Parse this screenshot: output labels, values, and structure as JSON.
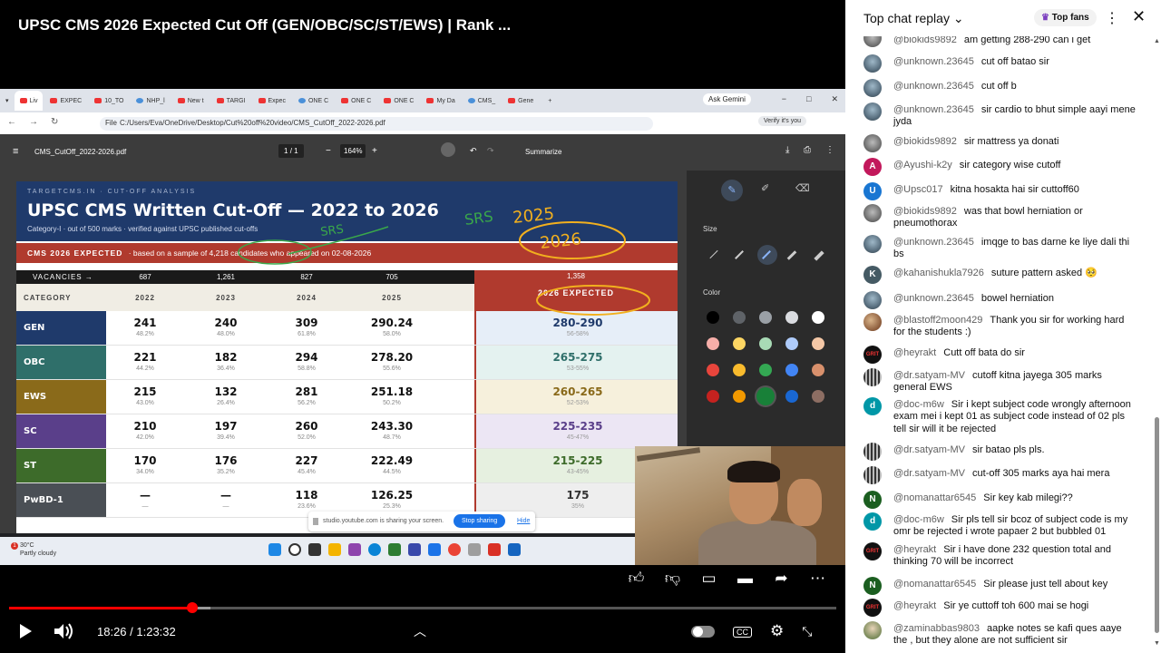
{
  "video": {
    "title": "UPSC CMS 2026 Expected Cut Off (GEN/OBC/SC/ST/EWS) | Rank ...",
    "current_time": "18:26",
    "duration": "1:23:32",
    "time_display": "18:26 / 1:23:32",
    "progress_fraction": 0.221
  },
  "browser": {
    "tabs": [
      "Liv",
      "EXPEC",
      "10_TO",
      "NHP_l",
      "New t",
      "TARGI",
      "Expec",
      "ONE C",
      "ONE C",
      "ONE C",
      "My Da",
      "CMS_",
      "Gene"
    ],
    "new_tab": "+",
    "ask_gemini": "Ask Gemini",
    "url_scheme": "File",
    "url": "C:/Users/Eva/OneDrive/Desktop/Cut%20off%20video/CMS_CutOff_2022-2026.pdf",
    "verify": "Verify it's you"
  },
  "pdf_viewer": {
    "filename": "CMS_CutOff_2022-2026.pdf",
    "page_current": "1",
    "page_sep": "/",
    "page_total": "1",
    "zoom": "164%",
    "summarize": "Summarize",
    "panel_size_label": "Size",
    "panel_color_label": "Color"
  },
  "document": {
    "kicker": "TARGETCMS.IN · CUT-OFF ANALYSIS",
    "title": "UPSC CMS Written Cut-Off — 2022 to 2026",
    "subtitle": "Category-I · out of 500 marks · verified against UPSC published cut-offs",
    "banner_label": "CMS 2026 EXPECTED",
    "banner_text": "· based on a sample of 4,218 candidates who appeared on 02-08-2026",
    "vacancies_label": "VACANCIES →",
    "vacancies": [
      "687",
      "1,261",
      "827",
      "705",
      "1,358"
    ],
    "category_header": "CATEGORY",
    "years": [
      "2022",
      "2023",
      "2024",
      "2025"
    ],
    "expected_header": "2026 EXPECTED",
    "rows": [
      {
        "cat": "GEN",
        "color": "#1f3a6b",
        "vals": [
          [
            "241",
            "48.2%"
          ],
          [
            "240",
            "48.0%"
          ],
          [
            "309",
            "61.8%"
          ],
          [
            "290.24",
            "58.0%"
          ]
        ],
        "exp": "280-290",
        "exp_pct": "56-58%",
        "exp_color": "#1f3a6b",
        "exp_bg": "#e6eef8"
      },
      {
        "cat": "OBC",
        "color": "#2f6f6a",
        "vals": [
          [
            "221",
            "44.2%"
          ],
          [
            "182",
            "36.4%"
          ],
          [
            "294",
            "58.8%"
          ],
          [
            "278.20",
            "55.6%"
          ]
        ],
        "exp": "265-275",
        "exp_pct": "53-55%",
        "exp_color": "#2f6f6a",
        "exp_bg": "#e4f2f0"
      },
      {
        "cat": "EWS",
        "color": "#8a6a1a",
        "vals": [
          [
            "215",
            "43.0%"
          ],
          [
            "132",
            "26.4%"
          ],
          [
            "281",
            "56.2%"
          ],
          [
            "251.18",
            "50.2%"
          ]
        ],
        "exp": "260-265",
        "exp_pct": "52-53%",
        "exp_color": "#8a6a1a",
        "exp_bg": "#f6f0dc"
      },
      {
        "cat": "SC",
        "color": "#5a3f8a",
        "vals": [
          [
            "210",
            "42.0%"
          ],
          [
            "197",
            "39.4%"
          ],
          [
            "260",
            "52.0%"
          ],
          [
            "243.30",
            "48.7%"
          ]
        ],
        "exp": "225-235",
        "exp_pct": "45-47%",
        "exp_color": "#5a3f8a",
        "exp_bg": "#ece6f4"
      },
      {
        "cat": "ST",
        "color": "#3d6b2a",
        "vals": [
          [
            "170",
            "34.0%"
          ],
          [
            "176",
            "35.2%"
          ],
          [
            "227",
            "45.4%"
          ],
          [
            "222.49",
            "44.5%"
          ]
        ],
        "exp": "215-225",
        "exp_pct": "43-45%",
        "exp_color": "#3d6b2a",
        "exp_bg": "#e6f0e0"
      },
      {
        "cat": "PwBD-1",
        "color": "#4a4f55",
        "vals": [
          [
            "—",
            "—"
          ],
          [
            "—",
            "—"
          ],
          [
            "118",
            "23.6%"
          ],
          [
            "126.25",
            "25.3%"
          ]
        ],
        "exp": "175",
        "exp_pct": "35%",
        "exp_color": "#333333",
        "exp_bg": "#eeeeee"
      }
    ],
    "handwriting": [
      "SRS",
      "2025",
      "2026",
      "SRS"
    ]
  },
  "sharing": {
    "text": "studio.youtube.com is sharing your screen.",
    "stop": "Stop sharing",
    "hide": "Hide"
  },
  "taskbar": {
    "temperature": "30°C",
    "condition": "Partly cloudy",
    "badge": "1"
  },
  "chat": {
    "title": "Top chat replay",
    "top_fans": "Top fans",
    "messages": [
      {
        "author": "@biokids9892",
        "text": "am getting 288-290 can i get",
        "avatar": "grey",
        "initial": ""
      },
      {
        "author": "@unknown.23645",
        "text": "cut off batao sir",
        "avatar": "photo",
        "initial": ""
      },
      {
        "author": "@unknown.23645",
        "text": "cut off b",
        "avatar": "photo",
        "initial": ""
      },
      {
        "author": "@unknown.23645",
        "text": "sir cardio to bhut simple aayi mene jyda",
        "avatar": "photo",
        "initial": ""
      },
      {
        "author": "@biokids9892",
        "text": "sir mattress ya donati",
        "avatar": "grey",
        "initial": ""
      },
      {
        "author": "@Ayushi-k2y",
        "text": "sir category wise cutoff",
        "avatar": "#c2185b",
        "initial": "A"
      },
      {
        "author": "@Upsc017",
        "text": "kitna hosakta hai sir cuttoff60",
        "avatar": "#1976d2",
        "initial": "U"
      },
      {
        "author": "@biokids9892",
        "text": "was that bowl herniation or pneumothorax",
        "avatar": "grey",
        "initial": ""
      },
      {
        "author": "@unknown.23645",
        "text": "imqge to bas darne ke liye dali thi bs",
        "avatar": "photo",
        "initial": ""
      },
      {
        "author": "@kahanishukla7926",
        "text": "suture pattern asked 🥺",
        "avatar": "#455a64",
        "initial": "K"
      },
      {
        "author": "@unknown.23645",
        "text": "bowel herniation",
        "avatar": "photo",
        "initial": ""
      },
      {
        "author": "@blastoff2moon429",
        "text": "Thank you sir for working hard for the students :)",
        "avatar": "blast",
        "initial": ""
      },
      {
        "author": "@heyrakt",
        "text": "Cutt off bata do sir",
        "avatar": "hey",
        "initial": "GRIT"
      },
      {
        "author": "@dr.satyam-MV",
        "text": "cutoff kitna jayega 305 marks general EWS",
        "avatar": "dr",
        "initial": ""
      },
      {
        "author": "@doc-m6w",
        "text": "Sir i kept subject code wrongly afternoon exam mei i kept 01 as subject code instead of 02 pls tell sir will it be rejected",
        "avatar": "#0097a7",
        "initial": "d"
      },
      {
        "author": "@dr.satyam-MV",
        "text": "sir batao pls pls.",
        "avatar": "dr",
        "initial": ""
      },
      {
        "author": "@dr.satyam-MV",
        "text": "cut-off 305 marks aya hai mera",
        "avatar": "dr",
        "initial": ""
      },
      {
        "author": "@nomanattar6545",
        "text": "Sir key kab milegi??",
        "avatar": "#1b5e20",
        "initial": "N"
      },
      {
        "author": "@doc-m6w",
        "text": "Sir pls tell sir bcoz of subject code is my omr be rejected i wrote papaer 2 but bubbled 01",
        "avatar": "#0097a7",
        "initial": "d"
      },
      {
        "author": "@heyrakt",
        "text": "Sir i have done 232 question total and thinking 70 will be incorrect",
        "avatar": "hey",
        "initial": "GRIT"
      },
      {
        "author": "@nomanattar6545",
        "text": "Sir please just tell about key",
        "avatar": "#1b5e20",
        "initial": "N"
      },
      {
        "author": "@heyrakt",
        "text": "Sir ye cuttoff toh 600 mai se hogi",
        "avatar": "hey",
        "initial": "GRIT"
      },
      {
        "author": "@zaminabbas9803",
        "text": "aapke notes se kafi ques aaye the , but they alone are not sufficient sir",
        "avatar": "zam",
        "initial": ""
      }
    ]
  }
}
